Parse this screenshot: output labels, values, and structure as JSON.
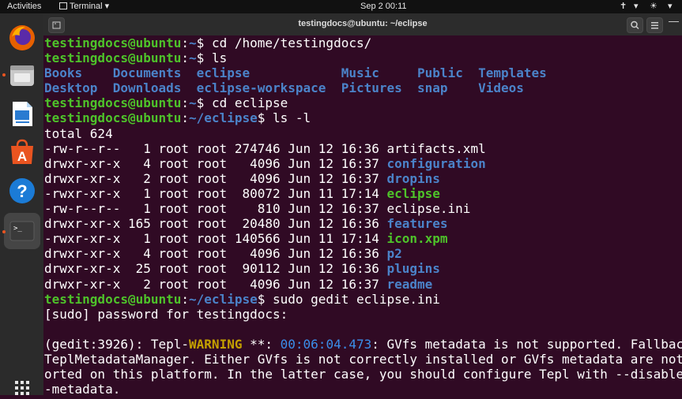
{
  "topbar": {
    "activities": "Activities",
    "app_name": "Terminal",
    "clock": "Sep 2  00:11"
  },
  "window": {
    "title": "testingdocs@ubuntu: ~/eclipse"
  },
  "colors": {
    "background": "#300a24",
    "user_green": "#4ec32a",
    "path_blue": "#4b83c9",
    "warning_yellow": "#c4a000",
    "accent_orange": "#e95420"
  },
  "terminal": {
    "lines": [
      [
        {
          "t": "testingdocs@ubuntu",
          "c": "u"
        },
        {
          "t": ":"
        },
        {
          "t": "~",
          "c": "p"
        },
        {
          "t": "$ cd /home/testingdocs/"
        }
      ],
      [
        {
          "t": "testingdocs@ubuntu",
          "c": "u"
        },
        {
          "t": ":"
        },
        {
          "t": "~",
          "c": "p"
        },
        {
          "t": "$ ls"
        }
      ],
      [
        {
          "t": "Books    ",
          "c": "dir"
        },
        {
          "t": "Documents  ",
          "c": "dir"
        },
        {
          "t": "eclipse            ",
          "c": "dir"
        },
        {
          "t": "Music     ",
          "c": "dir"
        },
        {
          "t": "Public  ",
          "c": "dir"
        },
        {
          "t": "Templates",
          "c": "dir"
        }
      ],
      [
        {
          "t": "Desktop  ",
          "c": "dir"
        },
        {
          "t": "Downloads  ",
          "c": "dir"
        },
        {
          "t": "eclipse-workspace  ",
          "c": "dir"
        },
        {
          "t": "Pictures  ",
          "c": "dir"
        },
        {
          "t": "snap    ",
          "c": "dir"
        },
        {
          "t": "Videos",
          "c": "dir"
        }
      ],
      [
        {
          "t": "testingdocs@ubuntu",
          "c": "u"
        },
        {
          "t": ":"
        },
        {
          "t": "~",
          "c": "p"
        },
        {
          "t": "$ cd eclipse"
        }
      ],
      [
        {
          "t": "testingdocs@ubuntu",
          "c": "u"
        },
        {
          "t": ":"
        },
        {
          "t": "~/eclipse",
          "c": "p"
        },
        {
          "t": "$ ls -l"
        }
      ],
      [
        {
          "t": "total 624"
        }
      ],
      [
        {
          "t": "-rw-r--r--   1 root root 274746 Jun 12 16:36 artifacts.xml"
        }
      ],
      [
        {
          "t": "drwxr-xr-x   4 root root   4096 Jun 12 16:37 "
        },
        {
          "t": "configuration",
          "c": "dir"
        }
      ],
      [
        {
          "t": "drwxr-xr-x   2 root root   4096 Jun 12 16:37 "
        },
        {
          "t": "dropins",
          "c": "dir"
        }
      ],
      [
        {
          "t": "-rwxr-xr-x   1 root root  80072 Jun 11 17:14 "
        },
        {
          "t": "eclipse",
          "c": "ex"
        }
      ],
      [
        {
          "t": "-rw-r--r--   1 root root    810 Jun 12 16:37 eclipse.ini"
        }
      ],
      [
        {
          "t": "drwxr-xr-x 165 root root  20480 Jun 12 16:36 "
        },
        {
          "t": "features",
          "c": "dir"
        }
      ],
      [
        {
          "t": "-rwxr-xr-x   1 root root 140566 Jun 11 17:14 "
        },
        {
          "t": "icon.xpm",
          "c": "ex"
        }
      ],
      [
        {
          "t": "drwxr-xr-x   4 root root   4096 Jun 12 16:36 "
        },
        {
          "t": "p2",
          "c": "dir"
        }
      ],
      [
        {
          "t": "drwxr-xr-x  25 root root  90112 Jun 12 16:36 "
        },
        {
          "t": "plugins",
          "c": "dir"
        }
      ],
      [
        {
          "t": "drwxr-xr-x   2 root root   4096 Jun 12 16:37 "
        },
        {
          "t": "readme",
          "c": "dir"
        }
      ],
      [
        {
          "t": "testingdocs@ubuntu",
          "c": "u"
        },
        {
          "t": ":"
        },
        {
          "t": "~/eclipse",
          "c": "p"
        },
        {
          "t": "$ sudo gedit eclipse.ini"
        }
      ],
      [
        {
          "t": "[sudo] password for testingdocs:"
        }
      ],
      [
        {
          "t": ""
        }
      ],
      [
        {
          "t": "(gedit:3926): Tepl-"
        },
        {
          "t": "WARNING",
          "c": "warn"
        },
        {
          "t": " **: "
        },
        {
          "t": "00:06:04.473",
          "c": "ts"
        },
        {
          "t": ": GVfs metadata is not supported. Fallback"
        }
      ],
      [
        {
          "t": "TeplMetadataManager. Either GVfs is not correctly installed or GVfs metadata are not"
        }
      ],
      [
        {
          "t": "orted on this platform. In the latter case, you should configure Tepl with --disable-"
        }
      ],
      [
        {
          "t": "-metadata."
        }
      ]
    ]
  }
}
